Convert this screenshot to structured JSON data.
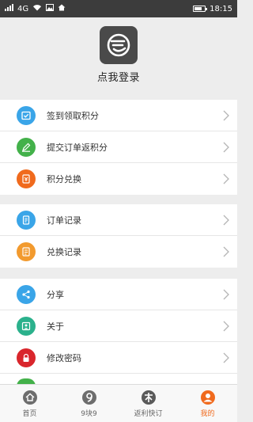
{
  "status_bar": {
    "network": "4G",
    "time": "18:15"
  },
  "header": {
    "login_text": "点我登录"
  },
  "groups": [
    {
      "items": [
        {
          "label": "签到领取积分",
          "icon": "checkin-icon",
          "color": "#3aa5e8"
        },
        {
          "label": "提交订单返积分",
          "icon": "pencil-icon",
          "color": "#43b14a"
        },
        {
          "label": "积分兑换",
          "icon": "points-icon",
          "color": "#f06a1d"
        }
      ]
    },
    {
      "items": [
        {
          "label": "订单记录",
          "icon": "document-icon",
          "color": "#3aa5e8"
        },
        {
          "label": "兑换记录",
          "icon": "exchange-icon",
          "color": "#f29a2e"
        }
      ]
    },
    {
      "items": [
        {
          "label": "分享",
          "icon": "share-icon",
          "color": "#3aa5e8"
        },
        {
          "label": "关于",
          "icon": "about-icon",
          "color": "#2bb18c"
        },
        {
          "label": "修改密码",
          "icon": "lock-icon",
          "color": "#d9262c"
        }
      ]
    }
  ],
  "tabs": [
    {
      "label": "首页",
      "icon": "home-icon",
      "active": false
    },
    {
      "label": "9块9",
      "icon": "nine-icon",
      "active": false
    },
    {
      "label": "返利快订",
      "icon": "rebate-icon",
      "active": false
    },
    {
      "label": "我的",
      "icon": "profile-icon",
      "active": true
    }
  ],
  "colors": {
    "accent": "#f06a1d",
    "status_bar": "#3c3c3c"
  }
}
